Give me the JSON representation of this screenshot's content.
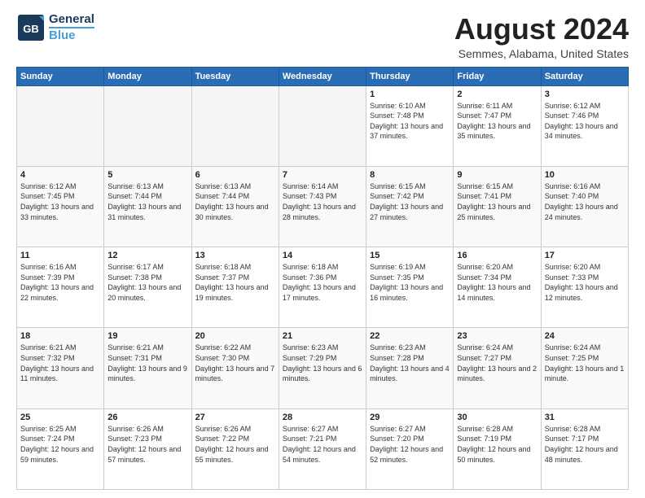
{
  "logo": {
    "line1": "General",
    "line2": "Blue"
  },
  "title": {
    "month_year": "August 2024",
    "location": "Semmes, Alabama, United States"
  },
  "calendar": {
    "headers": [
      "Sunday",
      "Monday",
      "Tuesday",
      "Wednesday",
      "Thursday",
      "Friday",
      "Saturday"
    ],
    "rows": [
      [
        {
          "day": "",
          "sunrise": "",
          "sunset": "",
          "daylight": "",
          "empty": true
        },
        {
          "day": "",
          "sunrise": "",
          "sunset": "",
          "daylight": "",
          "empty": true
        },
        {
          "day": "",
          "sunrise": "",
          "sunset": "",
          "daylight": "",
          "empty": true
        },
        {
          "day": "",
          "sunrise": "",
          "sunset": "",
          "daylight": "",
          "empty": true
        },
        {
          "day": "1",
          "sunrise": "Sunrise: 6:10 AM",
          "sunset": "Sunset: 7:48 PM",
          "daylight": "Daylight: 13 hours and 37 minutes.",
          "empty": false
        },
        {
          "day": "2",
          "sunrise": "Sunrise: 6:11 AM",
          "sunset": "Sunset: 7:47 PM",
          "daylight": "Daylight: 13 hours and 35 minutes.",
          "empty": false
        },
        {
          "day": "3",
          "sunrise": "Sunrise: 6:12 AM",
          "sunset": "Sunset: 7:46 PM",
          "daylight": "Daylight: 13 hours and 34 minutes.",
          "empty": false
        }
      ],
      [
        {
          "day": "4",
          "sunrise": "Sunrise: 6:12 AM",
          "sunset": "Sunset: 7:45 PM",
          "daylight": "Daylight: 13 hours and 33 minutes.",
          "empty": false
        },
        {
          "day": "5",
          "sunrise": "Sunrise: 6:13 AM",
          "sunset": "Sunset: 7:44 PM",
          "daylight": "Daylight: 13 hours and 31 minutes.",
          "empty": false
        },
        {
          "day": "6",
          "sunrise": "Sunrise: 6:13 AM",
          "sunset": "Sunset: 7:44 PM",
          "daylight": "Daylight: 13 hours and 30 minutes.",
          "empty": false
        },
        {
          "day": "7",
          "sunrise": "Sunrise: 6:14 AM",
          "sunset": "Sunset: 7:43 PM",
          "daylight": "Daylight: 13 hours and 28 minutes.",
          "empty": false
        },
        {
          "day": "8",
          "sunrise": "Sunrise: 6:15 AM",
          "sunset": "Sunset: 7:42 PM",
          "daylight": "Daylight: 13 hours and 27 minutes.",
          "empty": false
        },
        {
          "day": "9",
          "sunrise": "Sunrise: 6:15 AM",
          "sunset": "Sunset: 7:41 PM",
          "daylight": "Daylight: 13 hours and 25 minutes.",
          "empty": false
        },
        {
          "day": "10",
          "sunrise": "Sunrise: 6:16 AM",
          "sunset": "Sunset: 7:40 PM",
          "daylight": "Daylight: 13 hours and 24 minutes.",
          "empty": false
        }
      ],
      [
        {
          "day": "11",
          "sunrise": "Sunrise: 6:16 AM",
          "sunset": "Sunset: 7:39 PM",
          "daylight": "Daylight: 13 hours and 22 minutes.",
          "empty": false
        },
        {
          "day": "12",
          "sunrise": "Sunrise: 6:17 AM",
          "sunset": "Sunset: 7:38 PM",
          "daylight": "Daylight: 13 hours and 20 minutes.",
          "empty": false
        },
        {
          "day": "13",
          "sunrise": "Sunrise: 6:18 AM",
          "sunset": "Sunset: 7:37 PM",
          "daylight": "Daylight: 13 hours and 19 minutes.",
          "empty": false
        },
        {
          "day": "14",
          "sunrise": "Sunrise: 6:18 AM",
          "sunset": "Sunset: 7:36 PM",
          "daylight": "Daylight: 13 hours and 17 minutes.",
          "empty": false
        },
        {
          "day": "15",
          "sunrise": "Sunrise: 6:19 AM",
          "sunset": "Sunset: 7:35 PM",
          "daylight": "Daylight: 13 hours and 16 minutes.",
          "empty": false
        },
        {
          "day": "16",
          "sunrise": "Sunrise: 6:20 AM",
          "sunset": "Sunset: 7:34 PM",
          "daylight": "Daylight: 13 hours and 14 minutes.",
          "empty": false
        },
        {
          "day": "17",
          "sunrise": "Sunrise: 6:20 AM",
          "sunset": "Sunset: 7:33 PM",
          "daylight": "Daylight: 13 hours and 12 minutes.",
          "empty": false
        }
      ],
      [
        {
          "day": "18",
          "sunrise": "Sunrise: 6:21 AM",
          "sunset": "Sunset: 7:32 PM",
          "daylight": "Daylight: 13 hours and 11 minutes.",
          "empty": false
        },
        {
          "day": "19",
          "sunrise": "Sunrise: 6:21 AM",
          "sunset": "Sunset: 7:31 PM",
          "daylight": "Daylight: 13 hours and 9 minutes.",
          "empty": false
        },
        {
          "day": "20",
          "sunrise": "Sunrise: 6:22 AM",
          "sunset": "Sunset: 7:30 PM",
          "daylight": "Daylight: 13 hours and 7 minutes.",
          "empty": false
        },
        {
          "day": "21",
          "sunrise": "Sunrise: 6:23 AM",
          "sunset": "Sunset: 7:29 PM",
          "daylight": "Daylight: 13 hours and 6 minutes.",
          "empty": false
        },
        {
          "day": "22",
          "sunrise": "Sunrise: 6:23 AM",
          "sunset": "Sunset: 7:28 PM",
          "daylight": "Daylight: 13 hours and 4 minutes.",
          "empty": false
        },
        {
          "day": "23",
          "sunrise": "Sunrise: 6:24 AM",
          "sunset": "Sunset: 7:27 PM",
          "daylight": "Daylight: 13 hours and 2 minutes.",
          "empty": false
        },
        {
          "day": "24",
          "sunrise": "Sunrise: 6:24 AM",
          "sunset": "Sunset: 7:25 PM",
          "daylight": "Daylight: 13 hours and 1 minute.",
          "empty": false
        }
      ],
      [
        {
          "day": "25",
          "sunrise": "Sunrise: 6:25 AM",
          "sunset": "Sunset: 7:24 PM",
          "daylight": "Daylight: 12 hours and 59 minutes.",
          "empty": false
        },
        {
          "day": "26",
          "sunrise": "Sunrise: 6:26 AM",
          "sunset": "Sunset: 7:23 PM",
          "daylight": "Daylight: 12 hours and 57 minutes.",
          "empty": false
        },
        {
          "day": "27",
          "sunrise": "Sunrise: 6:26 AM",
          "sunset": "Sunset: 7:22 PM",
          "daylight": "Daylight: 12 hours and 55 minutes.",
          "empty": false
        },
        {
          "day": "28",
          "sunrise": "Sunrise: 6:27 AM",
          "sunset": "Sunset: 7:21 PM",
          "daylight": "Daylight: 12 hours and 54 minutes.",
          "empty": false
        },
        {
          "day": "29",
          "sunrise": "Sunrise: 6:27 AM",
          "sunset": "Sunset: 7:20 PM",
          "daylight": "Daylight: 12 hours and 52 minutes.",
          "empty": false
        },
        {
          "day": "30",
          "sunrise": "Sunrise: 6:28 AM",
          "sunset": "Sunset: 7:19 PM",
          "daylight": "Daylight: 12 hours and 50 minutes.",
          "empty": false
        },
        {
          "day": "31",
          "sunrise": "Sunrise: 6:28 AM",
          "sunset": "Sunset: 7:17 PM",
          "daylight": "Daylight: 12 hours and 48 minutes.",
          "empty": false
        }
      ]
    ]
  }
}
